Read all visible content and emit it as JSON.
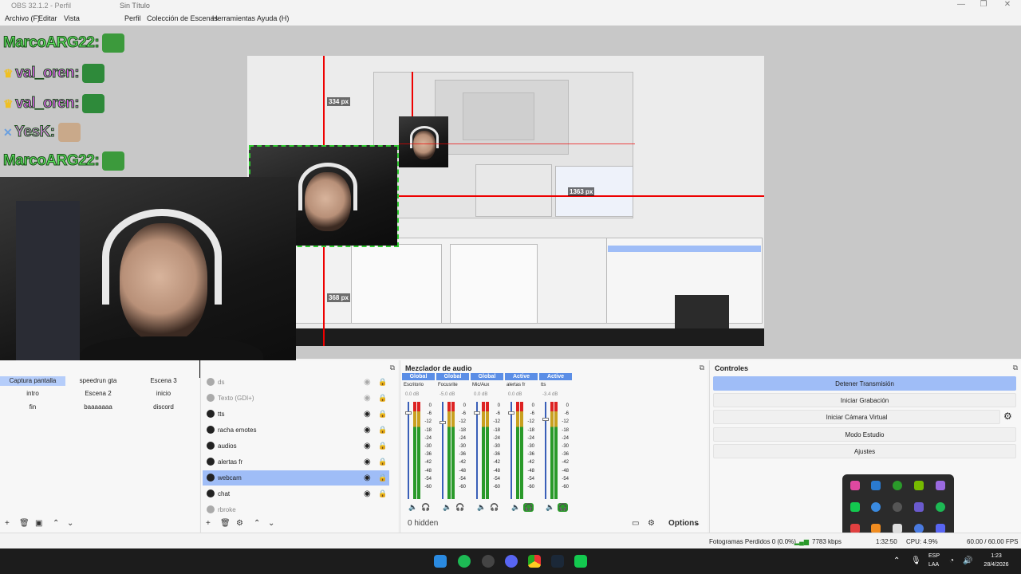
{
  "titlebar": {
    "app": "OBS 32.1.2 - Perfil",
    "scene_collection": "Sin Título",
    "minimize": "—",
    "maximize": "❐",
    "close": "✕"
  },
  "menu": {
    "file": "Archivo (F)",
    "edit": "Editar",
    "view": "Vista",
    "profile": "Perfil",
    "scene_collection": "Colección de Escenas",
    "tools": "Herramientas",
    "help": "Ayuda (H)"
  },
  "preview": {
    "label_334": "334 px",
    "label_368": "368 px",
    "label_1363": "1363 px"
  },
  "chat": {
    "lines": [
      {
        "user": "MarcoARG22",
        "color": "#5de35d"
      },
      {
        "user": "val_oren",
        "color": "#e060f0"
      },
      {
        "user": "val_oren",
        "color": "#e060f0"
      },
      {
        "user": "YesK",
        "color": "#d08ad8"
      },
      {
        "user": "MarcoARG22",
        "color": "#5de35d"
      }
    ]
  },
  "scenes": {
    "items": [
      "Captura pantalla",
      "speedrun gta",
      "Escena 3",
      "intro",
      "Escena 2",
      "inicio",
      "fin",
      "baaaaaaa",
      "discord"
    ],
    "active_index": 0
  },
  "sources": {
    "items": [
      {
        "name": "ds",
        "visible": false
      },
      {
        "name": "Texto (GDI+)",
        "visible": false
      },
      {
        "name": "tts",
        "visible": true
      },
      {
        "name": "racha emotes",
        "visible": true
      },
      {
        "name": "audios",
        "visible": true
      },
      {
        "name": "alertas fr",
        "visible": true
      },
      {
        "name": "webcam",
        "visible": true
      },
      {
        "name": "chat",
        "visible": true
      },
      {
        "name": "rbroke",
        "visible": false
      }
    ],
    "selected_index": 6
  },
  "mixer": {
    "title": "Mezclador de audio",
    "channels": [
      {
        "head": "Global",
        "name": "Escritorio",
        "db": "0.0 dB",
        "muted": false
      },
      {
        "head": "Global",
        "name": "Focusrite",
        "db": "-5.0 dB",
        "muted": false
      },
      {
        "head": "Global",
        "name": "Mic/Aux",
        "db": "0.0 dB",
        "muted": false
      },
      {
        "head": "Active",
        "name": "alertas fr",
        "db": "0.0 dB",
        "muted": false
      },
      {
        "head": "Active",
        "name": "tts",
        "db": "-3.4 dB",
        "muted": false
      }
    ],
    "scale": [
      "0",
      "-6",
      "-12",
      "-18",
      "-24",
      "-30",
      "-36",
      "-42",
      "-48",
      "-54",
      "-60"
    ],
    "hidden": "0 hidden",
    "options": "Options"
  },
  "controls": {
    "title": "Controles",
    "stop_stream": "Detener Transmisión",
    "start_recording": "Iniciar Grabación",
    "start_virtual_cam": "Iniciar Cámara Virtual",
    "studio_mode": "Modo Estudio",
    "settings": "Ajustes"
  },
  "status": {
    "dropped": "Fotogramas Perdidos 0 (0.0%)",
    "kbps": "7783 kbps",
    "time": "1:32:50",
    "cpu": "CPU: 4.9%",
    "fps": "60.00 / 60.00 FPS"
  },
  "taskbar": {
    "lang_top": "ESP",
    "lang_bottom": "LAA",
    "clock": "1:23",
    "date": "28/4/2026"
  },
  "icons": {
    "trash": "🗑",
    "settings": "⚙",
    "up": "⌃",
    "down": "⌄"
  }
}
